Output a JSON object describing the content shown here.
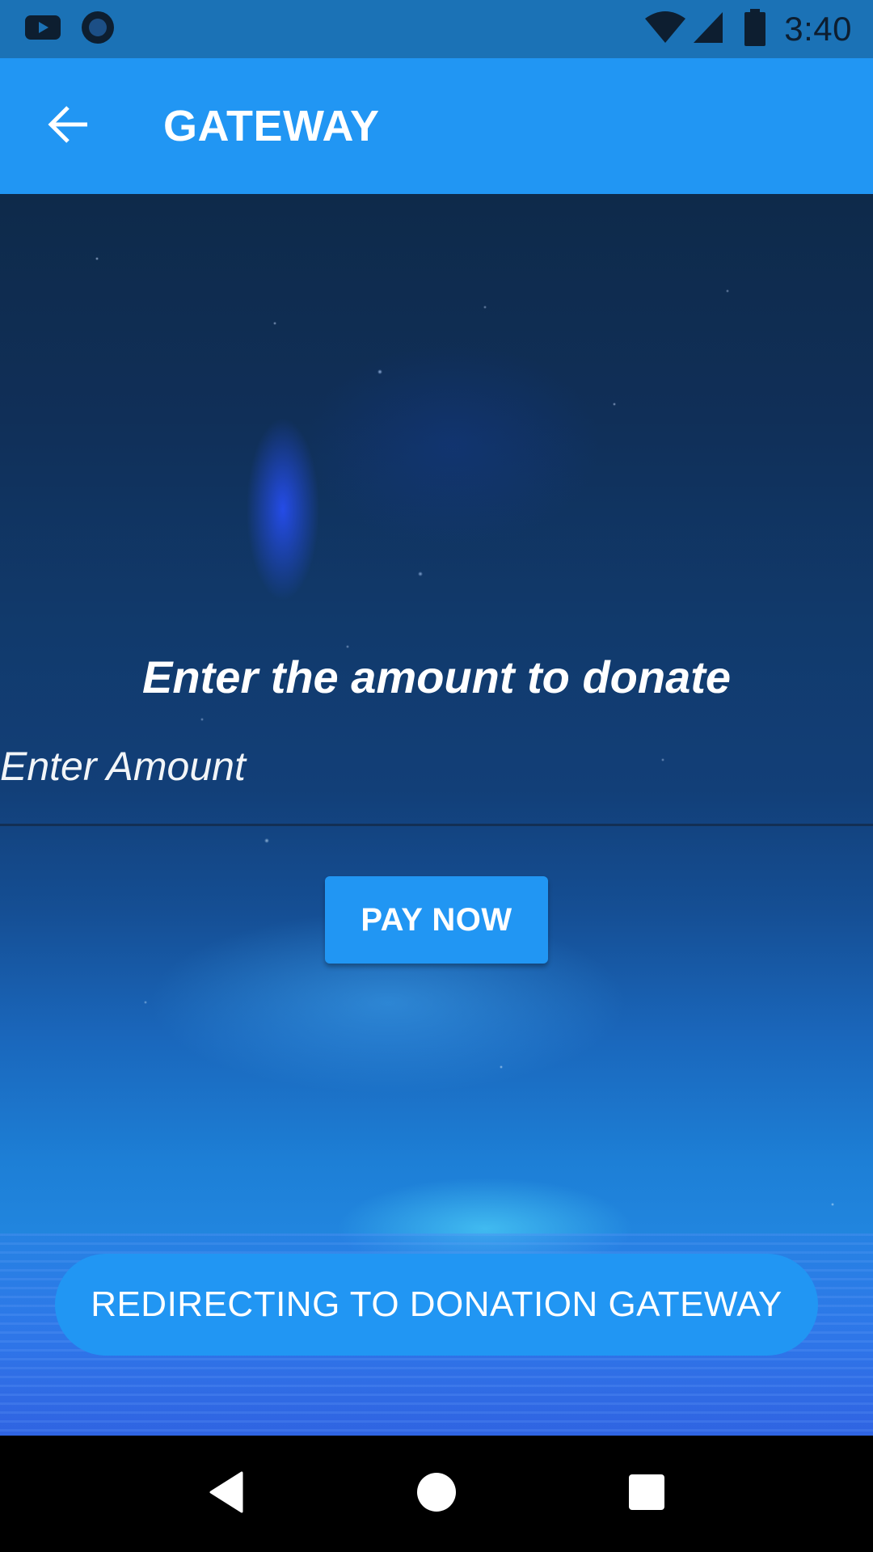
{
  "status_bar": {
    "time": "3:40",
    "left_icons": [
      "youtube-icon",
      "circle-app-icon"
    ],
    "right_icons": [
      "wifi-icon",
      "signal-icon",
      "battery-icon"
    ]
  },
  "app_bar": {
    "title": "GATEWAY",
    "back_icon": "arrow-back-icon",
    "color": "#2196f3"
  },
  "form": {
    "prompt": "Enter the amount to donate",
    "amount_placeholder": "Enter Amount",
    "amount_value": "",
    "pay_label": "PAY NOW"
  },
  "toast": {
    "message": "REDIRECTING TO DONATION GATEWAY"
  },
  "nav_bar": {
    "buttons": [
      "back-triangle-icon",
      "home-circle-icon",
      "recents-square-icon"
    ]
  }
}
